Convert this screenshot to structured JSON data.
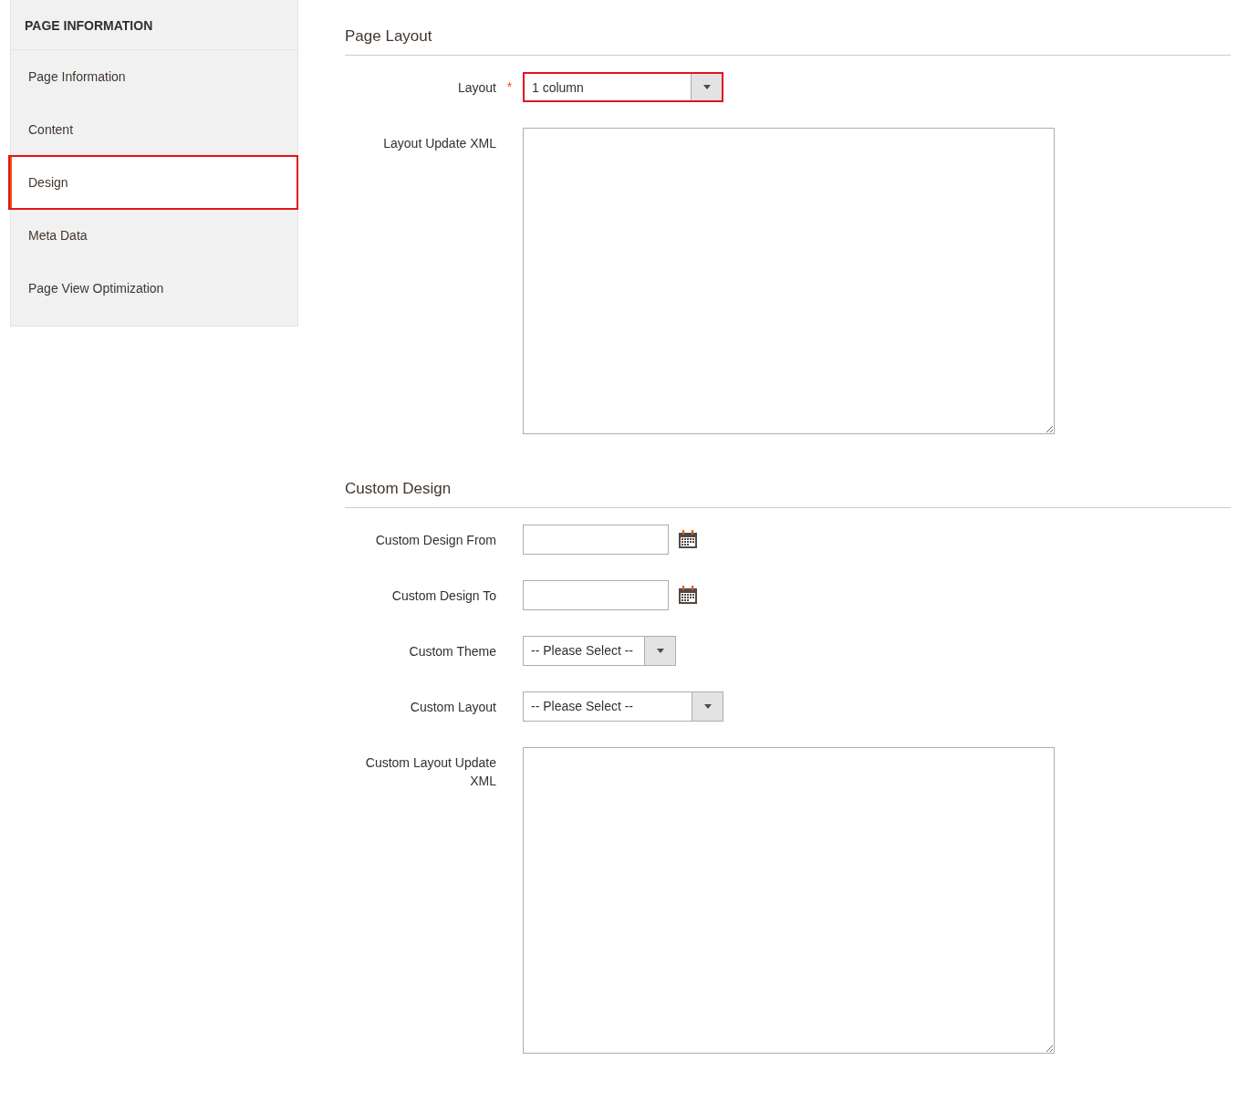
{
  "sidebar": {
    "title": "PAGE INFORMATION",
    "items": [
      {
        "label": "Page Information",
        "selected": false,
        "highlighted": false
      },
      {
        "label": "Content",
        "selected": false,
        "highlighted": false
      },
      {
        "label": "Design",
        "selected": true,
        "highlighted": true
      },
      {
        "label": "Meta Data",
        "selected": false,
        "highlighted": false
      },
      {
        "label": "Page View Optimization",
        "selected": false,
        "highlighted": false
      }
    ]
  },
  "sections": [
    {
      "title": "Page Layout",
      "fields": [
        {
          "kind": "select",
          "label": "Layout",
          "required_mark": "*",
          "value": "1 column",
          "highlighted": true
        },
        {
          "kind": "textarea",
          "label": "Layout Update XML",
          "highlighted": false
        }
      ]
    },
    {
      "title": "Custom Design",
      "fields": [
        {
          "kind": "date",
          "label": "Custom Design From",
          "highlighted": false
        },
        {
          "kind": "date",
          "label": "Custom Design To",
          "highlighted": false
        },
        {
          "kind": "select-short",
          "label": "Custom Theme",
          "value": "-- Please Select --",
          "highlighted": false
        },
        {
          "kind": "select",
          "label": "Custom Layout",
          "value": "-- Please Select --",
          "highlighted": false
        },
        {
          "kind": "textarea",
          "label": "Custom Layout Update XML",
          "highlighted": false
        }
      ]
    }
  ]
}
